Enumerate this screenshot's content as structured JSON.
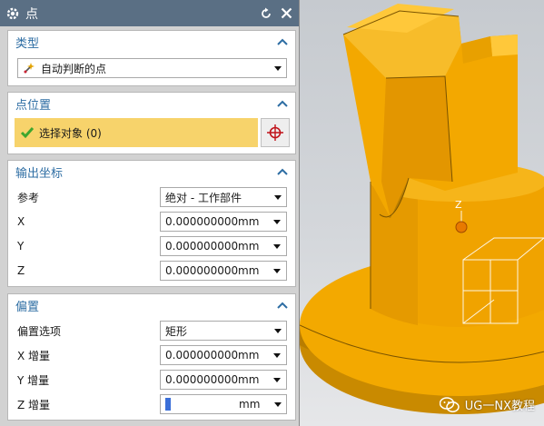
{
  "dialog": {
    "title": "点",
    "icons": {
      "title": "gear-icon",
      "reset": "reset-icon",
      "close": "close-icon"
    }
  },
  "type_group": {
    "title": "类型",
    "selected": "自动判断的点"
  },
  "point_location_group": {
    "title": "点位置",
    "select_label": "选择对象 (0)"
  },
  "output_coords_group": {
    "title": "输出坐标",
    "reference_label": "参考",
    "reference_value": "绝对 - 工作部件",
    "rows": [
      {
        "label": "X",
        "value": "0.0000000000",
        "unit": "mm"
      },
      {
        "label": "Y",
        "value": "0.0000000000",
        "unit": "mm"
      },
      {
        "label": "Z",
        "value": "0.0000000000",
        "unit": "mm"
      }
    ]
  },
  "offset_group": {
    "title": "偏置",
    "option_label": "偏置选项",
    "option_value": "矩形",
    "rows": [
      {
        "label": "X 增量",
        "value": "0.0000000000",
        "unit": "mm"
      },
      {
        "label": "Y 增量",
        "value": "0.0000000000",
        "unit": "mm"
      },
      {
        "label": "Z 增量",
        "value": "",
        "unit": "mm"
      }
    ]
  },
  "viewport": {
    "axis_z": "Z",
    "watermark": "UG一NX教程"
  },
  "colors": {
    "title_bar": "#5a6f84",
    "group_title": "#2d6da3",
    "select_highlight": "#f7d36b",
    "part_orange": "#f2a900",
    "check_green": "#3ea62e"
  }
}
